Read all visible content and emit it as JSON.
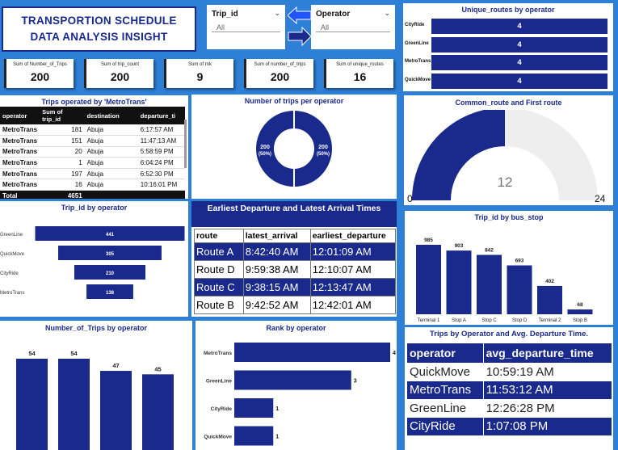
{
  "header": {
    "line1": "TRANSPORTION SCHEDULE",
    "line2": "DATA ANALYSIS INSIGHT"
  },
  "slicers": {
    "trip": {
      "label": "Trip_id",
      "value": "All"
    },
    "operator": {
      "label": "Operator",
      "value": "All"
    }
  },
  "unique_routes": {
    "title": "Unique_routes by operator",
    "rows": [
      {
        "operator": "CityRide",
        "value": "4"
      },
      {
        "operator": "GreenLine",
        "value": "4"
      },
      {
        "operator": "MetroTrans",
        "value": "4"
      },
      {
        "operator": "QuickMove",
        "value": "4"
      }
    ]
  },
  "cards": [
    {
      "label": "Sum of Number_of_Trips",
      "value": "200"
    },
    {
      "label": "Sum of trip_count",
      "value": "200"
    },
    {
      "label": "Sum of rnk",
      "value": "9"
    },
    {
      "label": "Sum of number_of_trips",
      "value": "200"
    },
    {
      "label": "Sum of unique_routes",
      "value": "16"
    }
  ],
  "metrotrans": {
    "title": "Trips operated by 'MetroTrans'",
    "headers": [
      "operator",
      "Sum of trip_id",
      "destination",
      "departure_ti"
    ],
    "rows": [
      [
        "MetroTrans",
        "181",
        "Abuja",
        "6:17:57 AM"
      ],
      [
        "MetroTrans",
        "151",
        "Abuja",
        "11:47:13 AM"
      ],
      [
        "MetroTrans",
        "20",
        "Abuja",
        "5:58:59 PM"
      ],
      [
        "MetroTrans",
        "1",
        "Abuja",
        "6:04:24 PM"
      ],
      [
        "MetroTrans",
        "197",
        "Abuja",
        "6:52:30 PM"
      ],
      [
        "MetroTrans",
        "16",
        "Abuja",
        "10:16:01 PM"
      ]
    ],
    "total_label": "Total",
    "total_value": "4651"
  },
  "donut": {
    "title": "Number of trips per operator",
    "left_label": "200",
    "left_pct": "(50%)",
    "right_label": "200",
    "right_pct": "(50%)"
  },
  "gauge": {
    "title": "Common_route and First route",
    "value": "12",
    "min": "0",
    "max": "24"
  },
  "routes_table": {
    "title": "Earliest Departure and Latest Arrival Times",
    "headers": [
      "route",
      "latest_arrival",
      "earliest_departure"
    ],
    "rows": [
      [
        "Route A",
        "8:42:40 AM",
        "12:01:09 AM"
      ],
      [
        "Route D",
        "9:59:38 AM",
        "12:10:07 AM"
      ],
      [
        "Route C",
        "9:38:15 AM",
        "12:13:47 AM"
      ],
      [
        "Route B",
        "9:42:52 AM",
        "12:42:01 AM"
      ]
    ]
  },
  "ops_table": {
    "title": "Trips by Operator and Avg. Departure Time.",
    "headers": [
      "operator",
      "avg_departure_time"
    ],
    "rows": [
      [
        "QuickMove",
        "10:59:19 AM"
      ],
      [
        "MetroTrans",
        "11:53:12 AM"
      ],
      [
        "GreenLine",
        "12:26:28 PM"
      ],
      [
        "CityRide",
        "1:07:08 PM"
      ]
    ]
  },
  "colors": {
    "accent": "#1a2a8c",
    "background": "#2e7fd6"
  },
  "chart_data": [
    {
      "type": "bar",
      "title": "Trip_id by operator",
      "categories": [
        "GreenLine",
        "QuickMove",
        "CityRide",
        "MetroTrans"
      ],
      "values": [
        441,
        305,
        210,
        138
      ]
    },
    {
      "type": "bar",
      "title": "Trip_id by bus_stop",
      "categories": [
        "Terminal 1",
        "Stop A",
        "Stop C",
        "Stop D",
        "Terminal 2",
        "Stop B"
      ],
      "values": [
        985,
        903,
        842,
        693,
        402,
        68
      ]
    },
    {
      "type": "bar",
      "title": "Number_of_Trips by operator",
      "categories": [
        "",
        "",
        "",
        ""
      ],
      "values": [
        54,
        54,
        47,
        45
      ]
    },
    {
      "type": "bar",
      "title": "Rank by operator",
      "categories": [
        "MetroTrans",
        "GreenLine",
        "CityRide",
        "QuickMove"
      ],
      "values": [
        4,
        3,
        1,
        1
      ]
    }
  ]
}
